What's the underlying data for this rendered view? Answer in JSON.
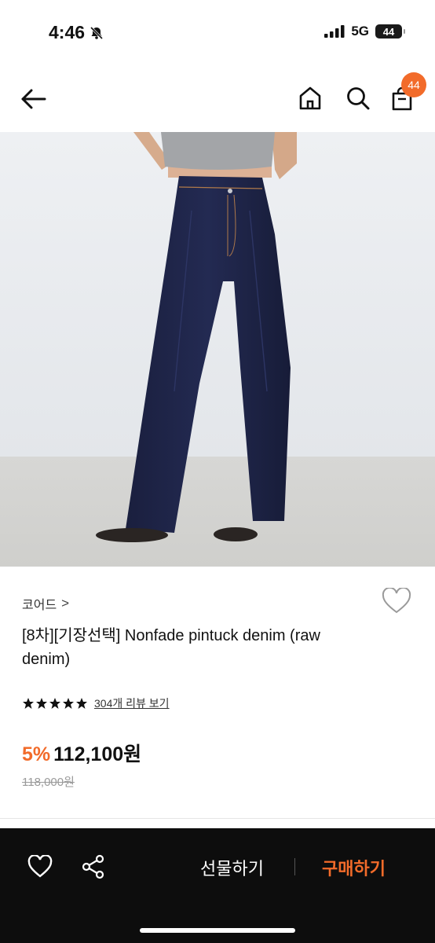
{
  "status_bar": {
    "time": "4:46",
    "network": "5G",
    "battery": "44"
  },
  "header": {
    "cart_count": "44"
  },
  "product": {
    "brand": "코어드",
    "brand_chevron": ">",
    "title": "[8차][기장선택] Nonfade pintuck denim (raw denim)",
    "rating_stars": 5,
    "review_link": "304개 리뷰 보기",
    "discount": "5%",
    "price": "112,100원",
    "original_price": "118,000원"
  },
  "bottom_bar": {
    "gift_label": "선물하기",
    "buy_label": "구매하기"
  },
  "colors": {
    "accent": "#f26b2a",
    "bar_bg": "#0d0d0d"
  }
}
